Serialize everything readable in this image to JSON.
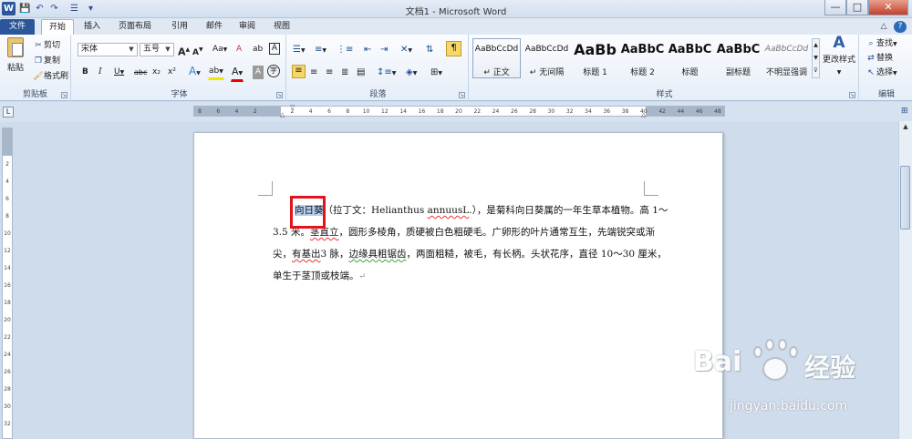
{
  "app": {
    "title": "文档1 - Microsoft Word",
    "word_icon": "W"
  },
  "quick_access": [
    {
      "name": "save-icon",
      "glyph": "💾"
    },
    {
      "name": "undo-icon",
      "glyph": "↶"
    },
    {
      "name": "redo-icon",
      "glyph": "↷"
    },
    {
      "name": "bullets-icon",
      "glyph": "☰"
    },
    {
      "name": "customize-icon",
      "glyph": "▾"
    }
  ],
  "window_controls": {
    "minimize": "—",
    "maximize": "□",
    "close": "✕"
  },
  "ribbon_controls": {
    "minimize_ribbon": "△",
    "help": "?"
  },
  "tabs": [
    "文件",
    "开始",
    "插入",
    "页面布局",
    "引用",
    "邮件",
    "审阅",
    "视图"
  ],
  "clipboard": {
    "paste": "粘贴",
    "cut": "剪切",
    "copy": "复制",
    "format_painter": "格式刷",
    "label": "剪贴板"
  },
  "font": {
    "name": "宋体",
    "size": "五号",
    "label": "字体",
    "grow": "A",
    "shrink": "A",
    "change_case": "Aa",
    "clear_format": "A",
    "phonetic": "ab",
    "char_border": "A",
    "bold": "B",
    "italic": "I",
    "underline": "U",
    "strike": "abc",
    "subscript": "x₂",
    "superscript": "x²",
    "text_effects": "A",
    "highlight": "ab",
    "font_color": "A",
    "char_shading": "A",
    "enclose": "字"
  },
  "paragraph": {
    "label": "段落"
  },
  "styles": {
    "label": "样式",
    "items": [
      {
        "preview": "AaBbCcDd",
        "name": "↵ 正文",
        "selected": true
      },
      {
        "preview": "AaBbCcDd",
        "name": "↵ 无间隔",
        "selected": false
      },
      {
        "preview": "AaBb",
        "name": "标题 1",
        "selected": false
      },
      {
        "preview": "AaBbC",
        "name": "标题 2",
        "selected": false
      },
      {
        "preview": "AaBbC",
        "name": "标题",
        "selected": false
      },
      {
        "preview": "AaBbC",
        "name": "副标题",
        "selected": false
      },
      {
        "preview": "AaBbCcDd",
        "name": "不明显强调",
        "selected": false
      }
    ],
    "change_styles": "更改样式"
  },
  "editing": {
    "find": "查找",
    "replace": "替换",
    "select": "选择",
    "label": "编辑"
  },
  "ruler": {
    "h_ticks": [
      "8",
      "6",
      "4",
      "2",
      "",
      "2",
      "4",
      "6",
      "8",
      "10",
      "12",
      "14",
      "16",
      "18",
      "20",
      "22",
      "24",
      "26",
      "28",
      "30",
      "32",
      "34",
      "36",
      "38",
      "40",
      "42",
      "44",
      "46",
      "48"
    ],
    "v_ticks": [
      "2",
      "4",
      "6",
      "8",
      "10",
      "12",
      "14",
      "16",
      "18",
      "20",
      "22",
      "24",
      "26",
      "28",
      "30",
      "32"
    ]
  },
  "document": {
    "highlighted": "向日葵",
    "line1_rest": "（拉丁文：Helianthus ",
    "spell1": "annuusL",
    "line1_end": ".），是菊科向日葵属的一年生草本植物。高 1～",
    "line2_start": "3.5 米。",
    "spell2": "茎直立",
    "line2_rest": "，圆形多棱角，质硬被白色粗硬毛。广卵形的叶片通常互生，先端锐突或渐",
    "line3_start": "尖，",
    "spell3": "有基出",
    "line3_mid": "3 脉，",
    "grammar1": "边缘具粗锯齿",
    "line3_rest": "，两面粗糙，被毛，有长柄。头状花序，直径 10～30 厘米，",
    "line4": "单生于茎顶或枝端。",
    "para_mark": "↵"
  },
  "watermark": {
    "brand_left": "Bai",
    "brand_right": "经验",
    "url": "jingyan.baidu.com"
  }
}
